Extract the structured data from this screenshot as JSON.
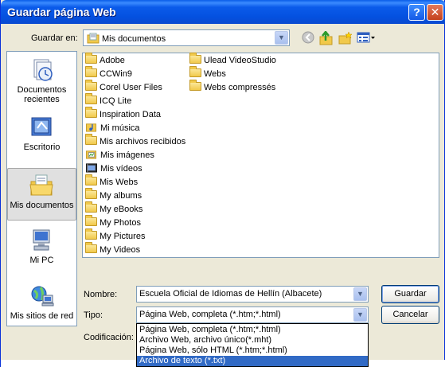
{
  "window": {
    "title": "Guardar página Web",
    "help_glyph": "?",
    "close_glyph": "✕"
  },
  "toolbar": {
    "save_in_label": "Guardar en:",
    "save_in_value": "Mis documentos",
    "icons": [
      "back-icon",
      "up-folder-icon",
      "new-folder-icon",
      "views-menu-icon"
    ]
  },
  "places": [
    {
      "label": "Documentos recientes",
      "icon": "recent-documents-icon"
    },
    {
      "label": "Escritorio",
      "icon": "desktop-icon"
    },
    {
      "label": "Mis documentos",
      "icon": "my-documents-icon",
      "selected": true
    },
    {
      "label": "Mi PC",
      "icon": "my-computer-icon"
    },
    {
      "label": "Mis sitios de red",
      "icon": "network-places-icon"
    }
  ],
  "files_col1": [
    {
      "name": "Adobe",
      "icon": "folder-icon"
    },
    {
      "name": "CCWin9",
      "icon": "folder-icon"
    },
    {
      "name": "Corel User Files",
      "icon": "folder-icon"
    },
    {
      "name": "ICQ Lite",
      "icon": "folder-icon"
    },
    {
      "name": "Inspiration Data",
      "icon": "folder-icon"
    },
    {
      "name": "Mi música",
      "icon": "music-folder-icon"
    },
    {
      "name": "Mis archivos recibidos",
      "icon": "folder-icon"
    },
    {
      "name": "Mis imágenes",
      "icon": "pictures-folder-icon"
    },
    {
      "name": "Mis vídeos",
      "icon": "videos-folder-icon"
    },
    {
      "name": "Mis Webs",
      "icon": "folder-icon"
    },
    {
      "name": "My albums",
      "icon": "folder-icon"
    },
    {
      "name": "My eBooks",
      "icon": "folder-icon"
    },
    {
      "name": "My Photos",
      "icon": "folder-icon"
    },
    {
      "name": "My Pictures",
      "icon": "folder-icon"
    },
    {
      "name": "My Videos",
      "icon": "folder-icon"
    }
  ],
  "files_col2": [
    {
      "name": "Ulead VideoStudio",
      "icon": "folder-icon"
    },
    {
      "name": "Webs",
      "icon": "folder-icon"
    },
    {
      "name": "Webs compressés",
      "icon": "folder-icon"
    }
  ],
  "form": {
    "name_label": "Nombre:",
    "name_value": "Escuela Oficial de Idiomas de Hellín (Albacete)",
    "type_label": "Tipo:",
    "type_value": "Página Web, completa (*.htm;*.html)",
    "encoding_label": "Codificación:"
  },
  "buttons": {
    "save": "Guardar",
    "cancel": "Cancelar"
  },
  "type_options": [
    "Página Web, completa (*.htm;*.html)",
    "Archivo Web, archivo único(*.mht)",
    "Página Web, sólo HTML (*.htm;*.html)",
    "Archivo de texto (*.txt)"
  ],
  "type_selected_index": 3
}
